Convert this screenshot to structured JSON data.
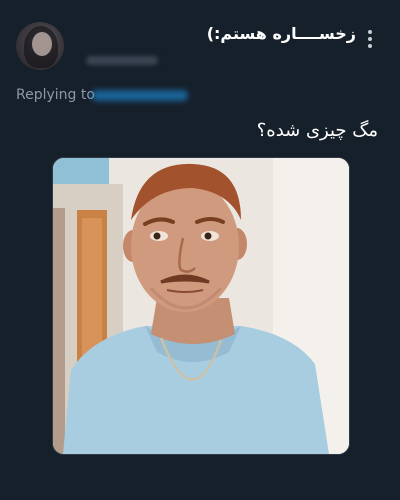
{
  "tweet": {
    "author_name": "زخســــاره هستم:)",
    "replying_to_label": "Replying to",
    "text": "مگ چیزی شده؟"
  },
  "icons": {
    "more": "more-vertical-icon"
  },
  "colors": {
    "background": "#16202b",
    "text_primary": "#ffffff",
    "text_secondary": "#8b98a5",
    "link": "#1d9bf0"
  }
}
